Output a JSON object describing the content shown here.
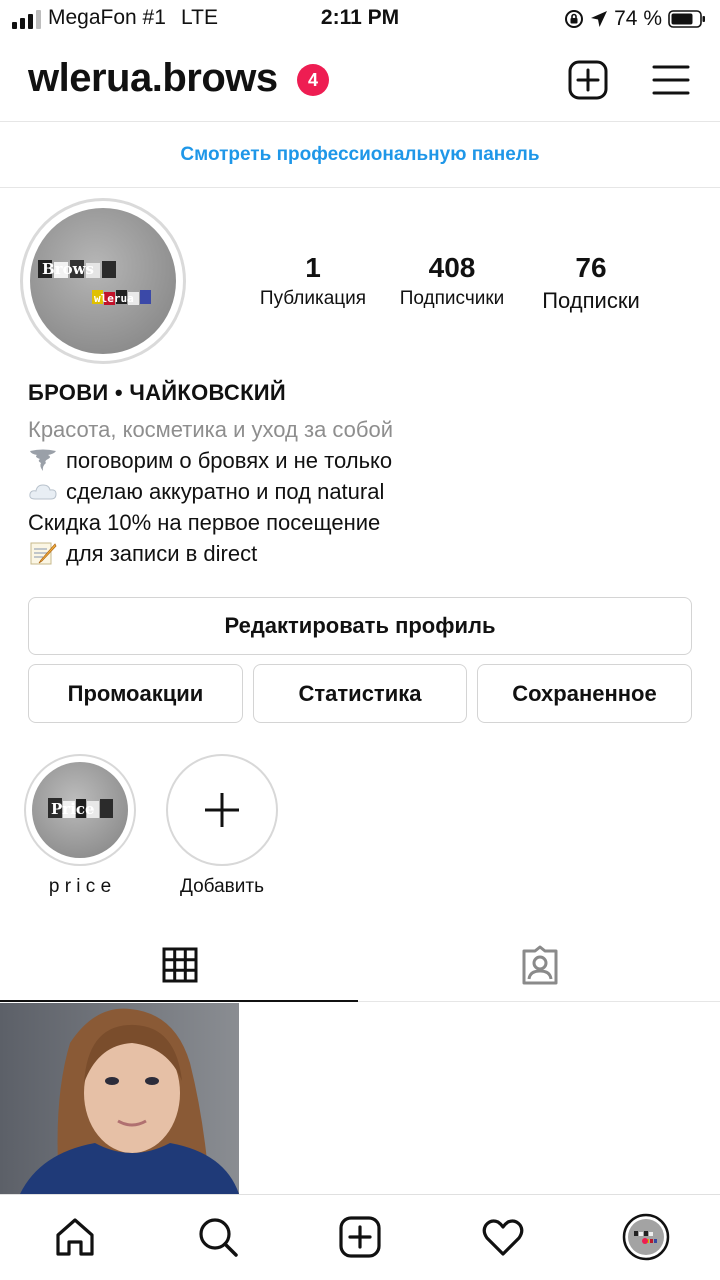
{
  "status_bar": {
    "carrier": "MegaFon #1",
    "network": "LTE",
    "time": "2:11 PM",
    "battery": "74 %"
  },
  "header": {
    "username": "wlerua.brows",
    "notification_count": "4"
  },
  "professional_dashboard": {
    "label": "Смотреть профессиональную панель",
    "color": "#1f97e8"
  },
  "profile": {
    "avatar_text_top": "Brows",
    "avatar_text_bottom": "wlerua",
    "stats": [
      {
        "value": "1",
        "label": "Публикация"
      },
      {
        "value": "408",
        "label": "Подписчики"
      },
      {
        "value": "76",
        "label": "Подписки"
      }
    ],
    "name": "БРОВИ • ЧАЙКОВСКИЙ",
    "category": "Красота, косметика и уход за собой",
    "bio_lines": [
      {
        "icon": "tornado-emoji",
        "text": "поговорим о бровях и не только"
      },
      {
        "icon": "cloud-emoji",
        "text": "сделаю аккуратно и под natural"
      },
      {
        "icon": "",
        "text": "Скидка 10% на первое посещение"
      },
      {
        "icon": "memo-emoji",
        "text": "для записи в direct"
      }
    ]
  },
  "buttons": {
    "edit_profile": "Редактировать профиль",
    "promotions": "Промоакции",
    "insights": "Статистика",
    "saved": "Сохраненное"
  },
  "highlights": [
    {
      "label": "p r i c e",
      "cover_text": "Price"
    },
    {
      "label": "Добавить",
      "icon": "plus-icon"
    }
  ],
  "tabs": [
    {
      "icon": "grid-icon",
      "active": true
    },
    {
      "icon": "tagged-icon",
      "active": false
    }
  ],
  "bottom_nav": [
    "home-icon",
    "search-icon",
    "new-post-icon",
    "heart-icon",
    "profile-avatar"
  ],
  "colors": {
    "accent": "#1f97e8",
    "badge": "#ee1d52",
    "secondary_text": "#8e8e8e"
  }
}
